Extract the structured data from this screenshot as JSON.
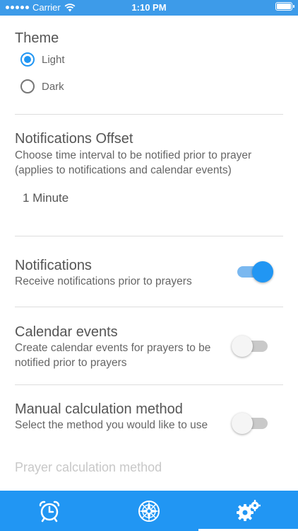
{
  "status_bar": {
    "carrier": "Carrier",
    "time": "1:10 PM"
  },
  "theme": {
    "title": "Theme",
    "options": [
      {
        "label": "Light",
        "selected": true
      },
      {
        "label": "Dark",
        "selected": false
      }
    ]
  },
  "notifications_offset": {
    "title": "Notifications Offset",
    "description": "Choose time interval to be notified prior to prayer (applies to notifications and calendar events)",
    "value": "1 Minute"
  },
  "notifications": {
    "title": "Notifications",
    "description": "Receive notifications prior to prayers",
    "enabled": true
  },
  "calendar_events": {
    "title": "Calendar events",
    "description": "Create calendar events for prayers to be notified prior to prayers",
    "enabled": false
  },
  "manual_calculation": {
    "title": "Manual calculation method",
    "description": "Select the method you would like to use",
    "enabled": false
  },
  "prayer_calculation": {
    "label": "Prayer calculation method"
  },
  "bottom_nav": {
    "items": [
      {
        "icon": "alarm-clock-icon",
        "active": false
      },
      {
        "icon": "compass-icon",
        "active": false
      },
      {
        "icon": "settings-gears-icon",
        "active": true
      }
    ]
  },
  "colors": {
    "accent": "#2196f3",
    "status_bar": "#3d9be9",
    "disabled_text": "#c8c8c8"
  }
}
